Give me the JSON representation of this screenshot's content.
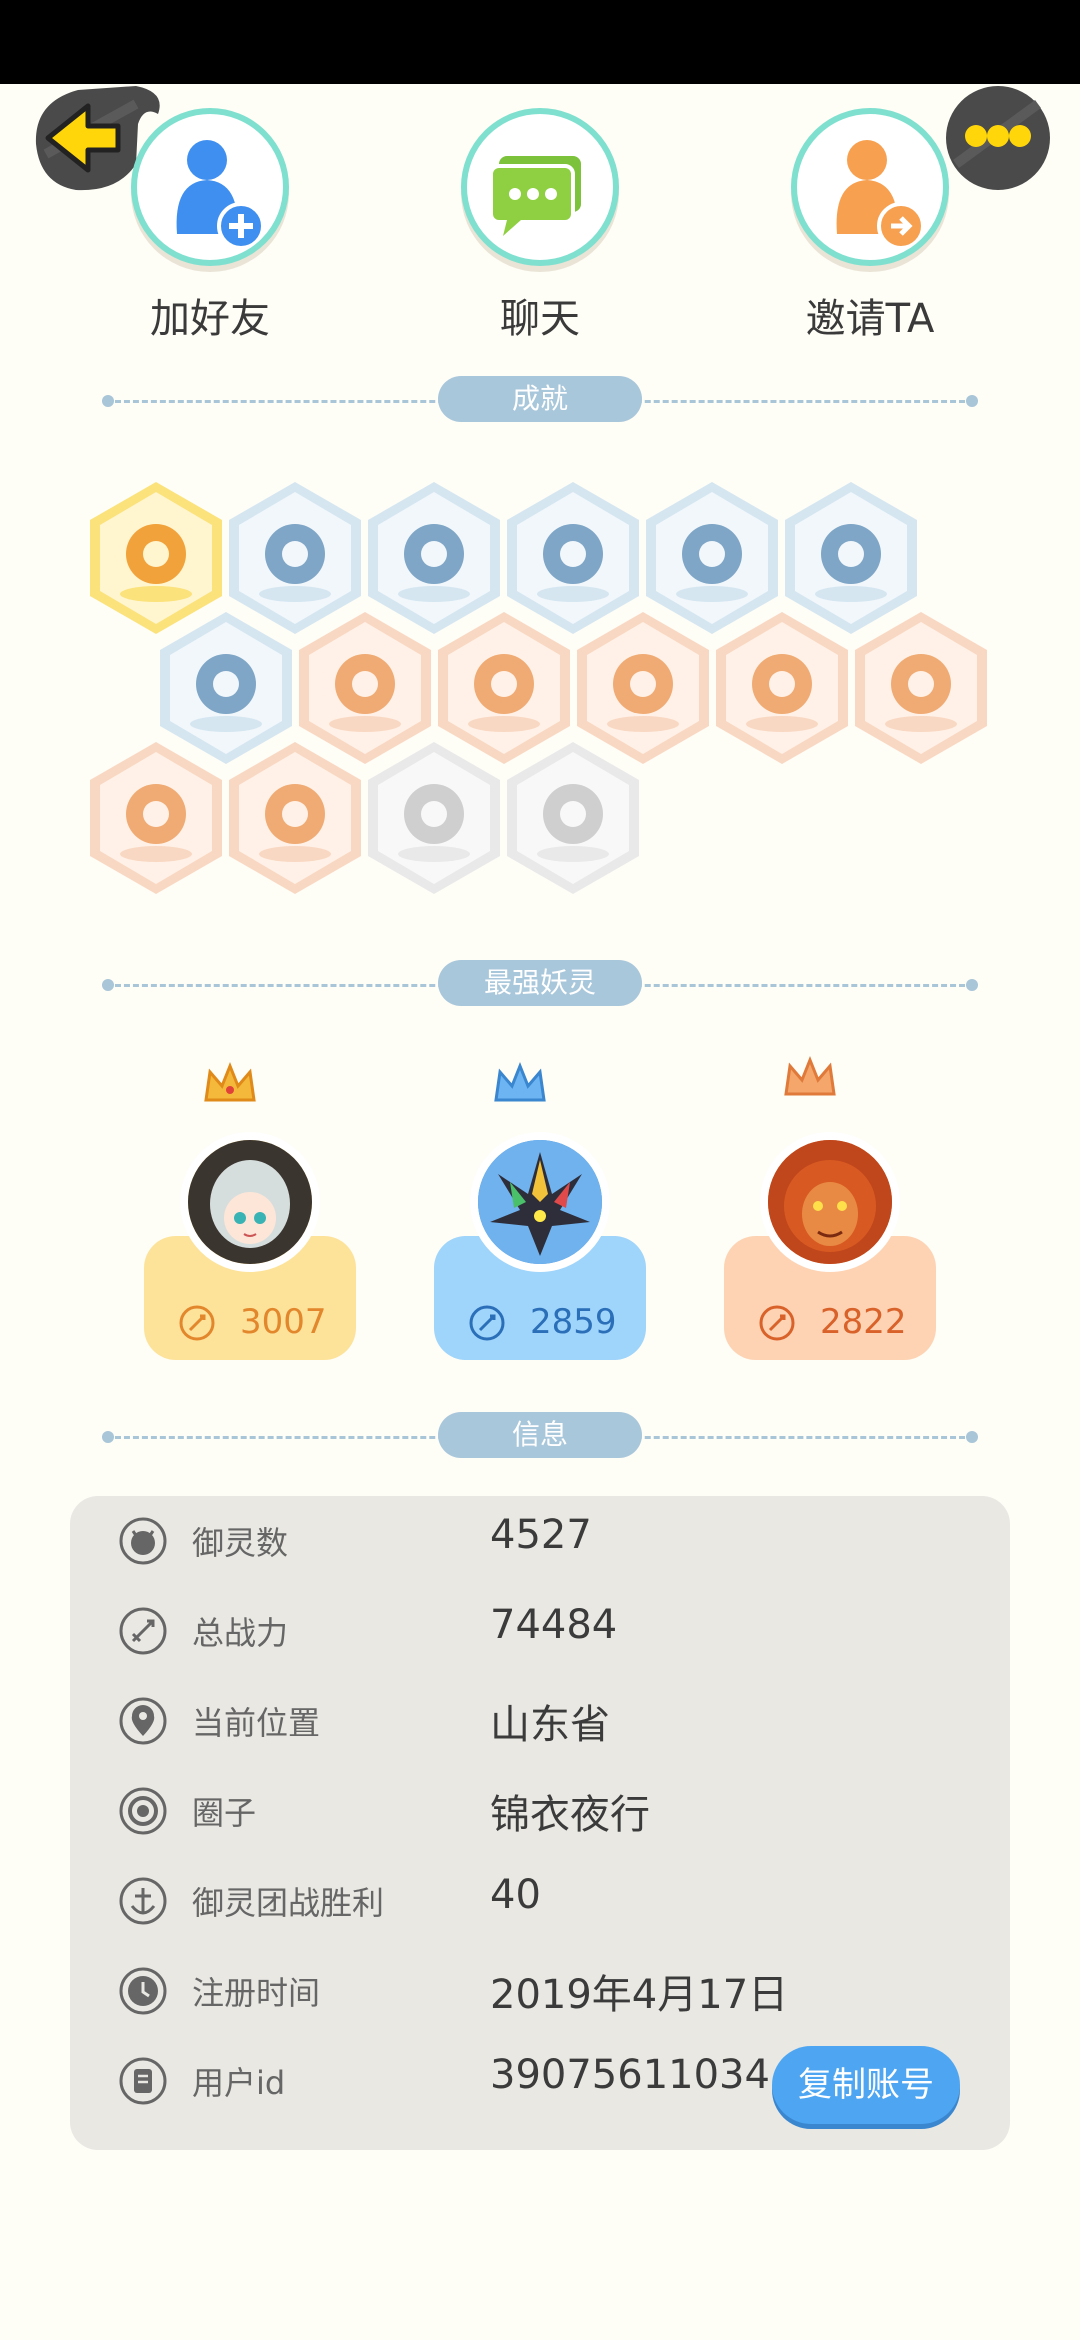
{
  "actions": {
    "add_friend": "加好友",
    "chat": "聊天",
    "invite": "邀请TA"
  },
  "sections": {
    "achievements": "成就",
    "strongest": "最强妖灵",
    "info": "信息"
  },
  "achievement_badges": [
    {
      "icon": "fox-face-badge-icon",
      "tone": "gold"
    },
    {
      "icon": "portal-orb-badge-icon",
      "tone": "blue"
    },
    {
      "icon": "moon-badge-icon",
      "tone": "blue"
    },
    {
      "icon": "crystal-ball-badge-icon",
      "tone": "blue"
    },
    {
      "icon": "yin-yang-wave-badge-icon",
      "tone": "blue"
    },
    {
      "icon": "yin-yang-scroll-badge-icon",
      "tone": "blue"
    },
    {
      "icon": "shield-badge-icon",
      "tone": "blue"
    },
    {
      "icon": "sneaker-badge-icon",
      "tone": "orange"
    },
    {
      "icon": "gem-badge-icon",
      "tone": "orange"
    },
    {
      "icon": "gingerbread-badge-icon",
      "tone": "orange"
    },
    {
      "icon": "stroller-badge-icon",
      "tone": "orange"
    },
    {
      "icon": "cat-flower-badge-icon",
      "tone": "orange"
    },
    {
      "icon": "horned-beast-badge-icon",
      "tone": "orange"
    },
    {
      "icon": "cat-back-badge-icon",
      "tone": "orange"
    },
    {
      "icon": "dragon-badge-icon",
      "tone": "gray"
    },
    {
      "icon": "fox-book-badge-icon",
      "tone": "gray"
    }
  ],
  "strongest_spirits": [
    {
      "power": "3007",
      "avatar": "silver-hair-girl-avatar",
      "crown": "gold-crown-icon"
    },
    {
      "power": "2859",
      "avatar": "rainbow-bird-avatar",
      "crown": "blue-crown-icon"
    },
    {
      "power": "2822",
      "avatar": "fire-lion-avatar",
      "crown": "bronze-crown-icon"
    }
  ],
  "info": {
    "rows": [
      {
        "label": "御灵数",
        "value": "4527",
        "icon": "spirit-count-icon"
      },
      {
        "label": "总战力",
        "value": "74484",
        "icon": "sword-icon"
      },
      {
        "label": "当前位置",
        "value": "山东省",
        "icon": "location-pin-icon"
      },
      {
        "label": "圈子",
        "value": "锦衣夜行",
        "icon": "circle-target-icon"
      },
      {
        "label": "御灵团战胜利",
        "value": "40",
        "icon": "anchor-icon"
      },
      {
        "label": "注册时间",
        "value": "2019年4月17日",
        "icon": "clock-icon"
      },
      {
        "label": "用户id",
        "value": "39075611034",
        "icon": "id-card-icon"
      }
    ],
    "copy_button": "复制账号"
  },
  "colors": {
    "background": "#fefdf6",
    "gold_card": "#fde29a",
    "blue_card": "#9fd4fb",
    "orange_card": "#fdd3b3",
    "copy_button": "#4ea6f2",
    "section_pill": "#a9c7db"
  }
}
